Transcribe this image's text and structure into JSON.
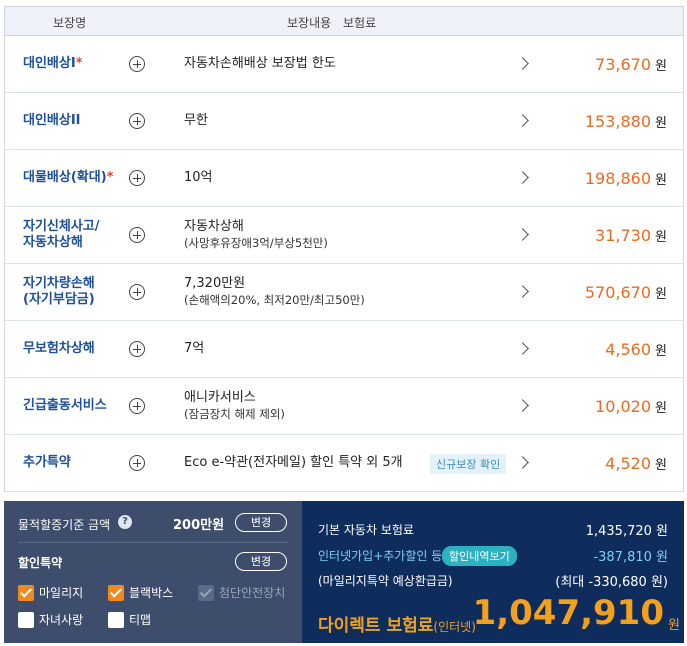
{
  "header": {
    "col_name": "보장명",
    "col_content": "보장내용",
    "col_premium": "보험료"
  },
  "rows": [
    {
      "name": "대인배상I",
      "star": "*",
      "desc": "자동차손해배상 보장법 한도",
      "sub": "",
      "price": "73,670",
      "unit": "원"
    },
    {
      "name": "대인배상II",
      "star": "",
      "desc": "무한",
      "sub": "",
      "price": "153,880",
      "unit": "원"
    },
    {
      "name": "대물배상(확대)",
      "star": "*",
      "desc": "10억",
      "sub": "",
      "price": "198,860",
      "unit": "원"
    },
    {
      "name": "자기신체사고/",
      "name2": "자동차상해",
      "star": "",
      "desc": "자동차상해",
      "sub": "(사망후유장애3억/부상5천만)",
      "price": "31,730",
      "unit": "원"
    },
    {
      "name": "자기차량손해",
      "name2": "(자기부담금)",
      "star": "",
      "desc": "7,320만원",
      "sub": "(손해액의20%, 최저20만/최고50만)",
      "price": "570,670",
      "unit": "원"
    },
    {
      "name": "무보험차상해",
      "star": "",
      "desc": "7억",
      "sub": "",
      "price": "4,560",
      "unit": "원"
    },
    {
      "name": "긴급출동서비스",
      "star": "",
      "desc": "애니카서비스",
      "sub": "(잠금장치 해제 제외)",
      "price": "10,020",
      "unit": "원"
    },
    {
      "name": "추가특약",
      "star": "",
      "desc": "Eco e-약관(전자메일) 할인 특약 외 5개",
      "sub": "",
      "badge": "신규보장 확인",
      "price": "4,520",
      "unit": "원"
    }
  ],
  "property": {
    "label": "물적할증기준 금액",
    "help": "?",
    "amount": "200만원",
    "change": "변경"
  },
  "discount": {
    "label": "할인특약",
    "change": "변경",
    "options": [
      {
        "label": "마일리지",
        "state": "on"
      },
      {
        "label": "블랙박스",
        "state": "on"
      },
      {
        "label": "첨단안전장치",
        "state": "dis"
      },
      {
        "label": "자녀사랑",
        "state": "off"
      },
      {
        "label": "티맵",
        "state": "off"
      }
    ]
  },
  "summary": {
    "base_label": "기본 자동차 보험료",
    "base_value": "1,435,720 원",
    "disc_label": "인터넷가입+추가할인 등",
    "disc_badge": "할인내역보기",
    "disc_value": "-387,810 원",
    "mileage_label": "(마일리지특약 예상환급금)",
    "mileage_value": "(최대 -330,680 원)",
    "final_label": "다이렉트 보험료",
    "final_label_small": "(인터넷)",
    "final_value": "1,047,910",
    "final_unit": "원"
  },
  "colors": {
    "accent": "#ee6a20",
    "navy": "#0f2d5c",
    "slate": "#3d4d6b",
    "name_blue": "#1d4f9c",
    "gold": "#f3a01c"
  }
}
